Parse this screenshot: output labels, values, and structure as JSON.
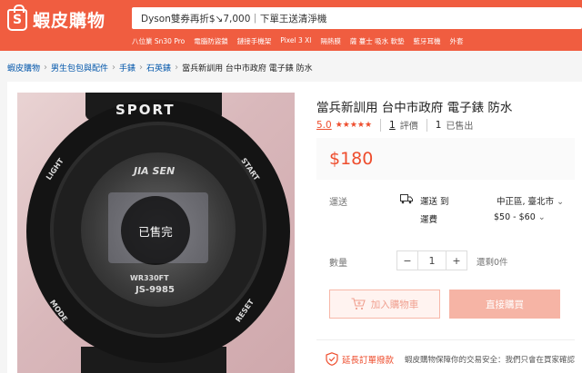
{
  "header": {
    "logo_text": "蝦皮購物",
    "logo_mark": "S",
    "search_placeholder": "Dyson雙券再折$↘7,000｜下單王送清淨機",
    "hot_keywords": [
      "八位業 Sn30 Pro",
      "電腦防盜鎖",
      "鏈接手機架",
      "Pixel 3 Xl",
      "隔熱膜",
      "薩 蔓士 吸水 軟墊",
      "藍牙耳機",
      "外套"
    ]
  },
  "breadcrumb": {
    "items": [
      "蝦皮購物",
      "男生包包與配件",
      "手錶",
      "石英錶"
    ],
    "separator": "›",
    "current": "當兵新訓用 台中市政府 電子錶 防水"
  },
  "product_image": {
    "sold_out_label": "已售完",
    "watch_labels": {
      "sport": "SPORT",
      "brand": "JIA SEN",
      "light": "LIGHT",
      "start": "START",
      "mode": "MODE",
      "reset": "RESET",
      "water_resist": "WR330FT",
      "model": "JS-9985"
    }
  },
  "product": {
    "title": "當兵新訓用 台中市政府 電子錶 防水",
    "rating": "5.0",
    "stars": "★★★★★",
    "star_count": 5,
    "review_count": "1",
    "review_label": "評價",
    "sold_count": "1",
    "sold_label": "已售出",
    "price": "$180"
  },
  "shipping": {
    "label": "運送",
    "to_label": "運送 到",
    "location": "中正區, 臺北市",
    "fee_label": "運費",
    "fee": "$50 - $60"
  },
  "quantity": {
    "label": "數量",
    "minus": "−",
    "value": "1",
    "plus": "+",
    "stock": "還剩0件"
  },
  "actions": {
    "add_to_cart": "加入購物車",
    "buy_now": "直接購買"
  },
  "guarantee": {
    "title": "延長訂單撥款",
    "desc": "蝦皮購物保障你的交易安全：我們只會在買家確認"
  },
  "colors": {
    "brand": "#f05d40",
    "accent": "#ee4d2d"
  }
}
